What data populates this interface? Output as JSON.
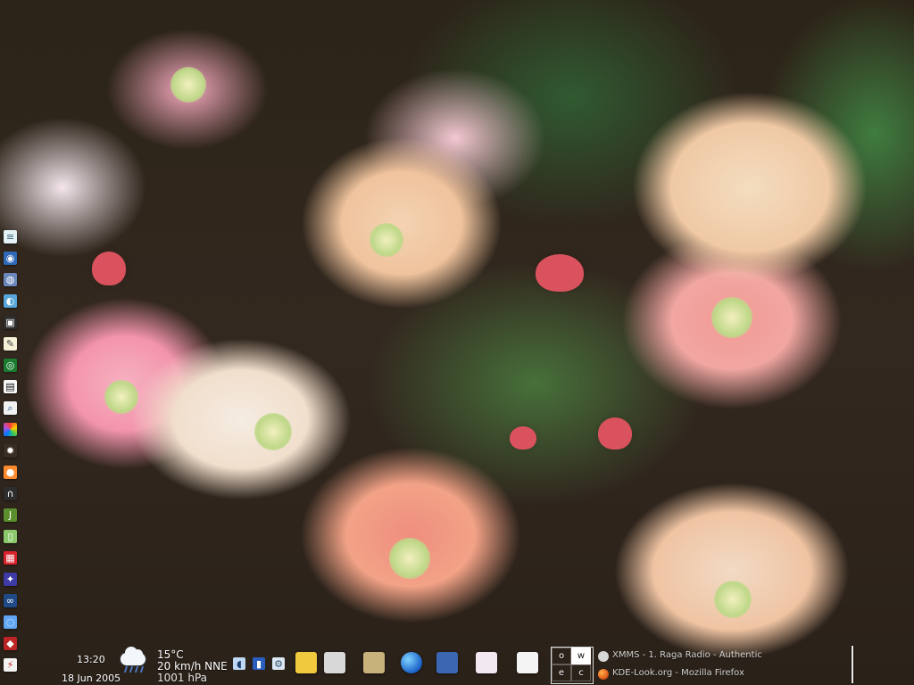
{
  "desktop": {
    "wallpaper_description": "Pink, peach and cream verbena flowers with green foliage",
    "left_launcher_icons": [
      "server-icon",
      "globe-icon",
      "world-icon",
      "earth-icon",
      "terminal-icon",
      "notes-icon",
      "network-icon",
      "calendar-icon",
      "search-icon",
      "color-wheel-icon",
      "spider-icon",
      "music-icon",
      "headphones-icon",
      "java-icon",
      "phone-icon",
      "photo-icon",
      "messenger-icon",
      "link-icon",
      "disk-icon",
      "transmit-icon",
      "lightning-icon"
    ]
  },
  "taskbar": {
    "clock": {
      "time": "13:20",
      "date": "18 Jun 2005"
    },
    "weather": {
      "temperature": "15°C",
      "wind": "20 km/h NNE",
      "pressure": "1001 hPa",
      "icon": "rain-cloud-icon"
    },
    "system_tray_icons": [
      "speaker-icon",
      "battery-icon",
      "settings-icon"
    ],
    "quick_launchers": [
      "package-icon",
      "tools-icon",
      "file-cabinet-icon",
      "globe-browser-icon",
      "dictionary-icon",
      "network-monitor-icon",
      "kate-icon"
    ],
    "pager": {
      "desktops": [
        "o",
        "w",
        "e",
        "c"
      ],
      "active_index": 1
    },
    "tasks": [
      {
        "title": "XMMS - 1. Raga Radio - Authentic",
        "icon": "music-player-icon"
      },
      {
        "title": "KDE-Look.org - Mozilla Firefox",
        "icon": "firefox-icon"
      }
    ]
  }
}
